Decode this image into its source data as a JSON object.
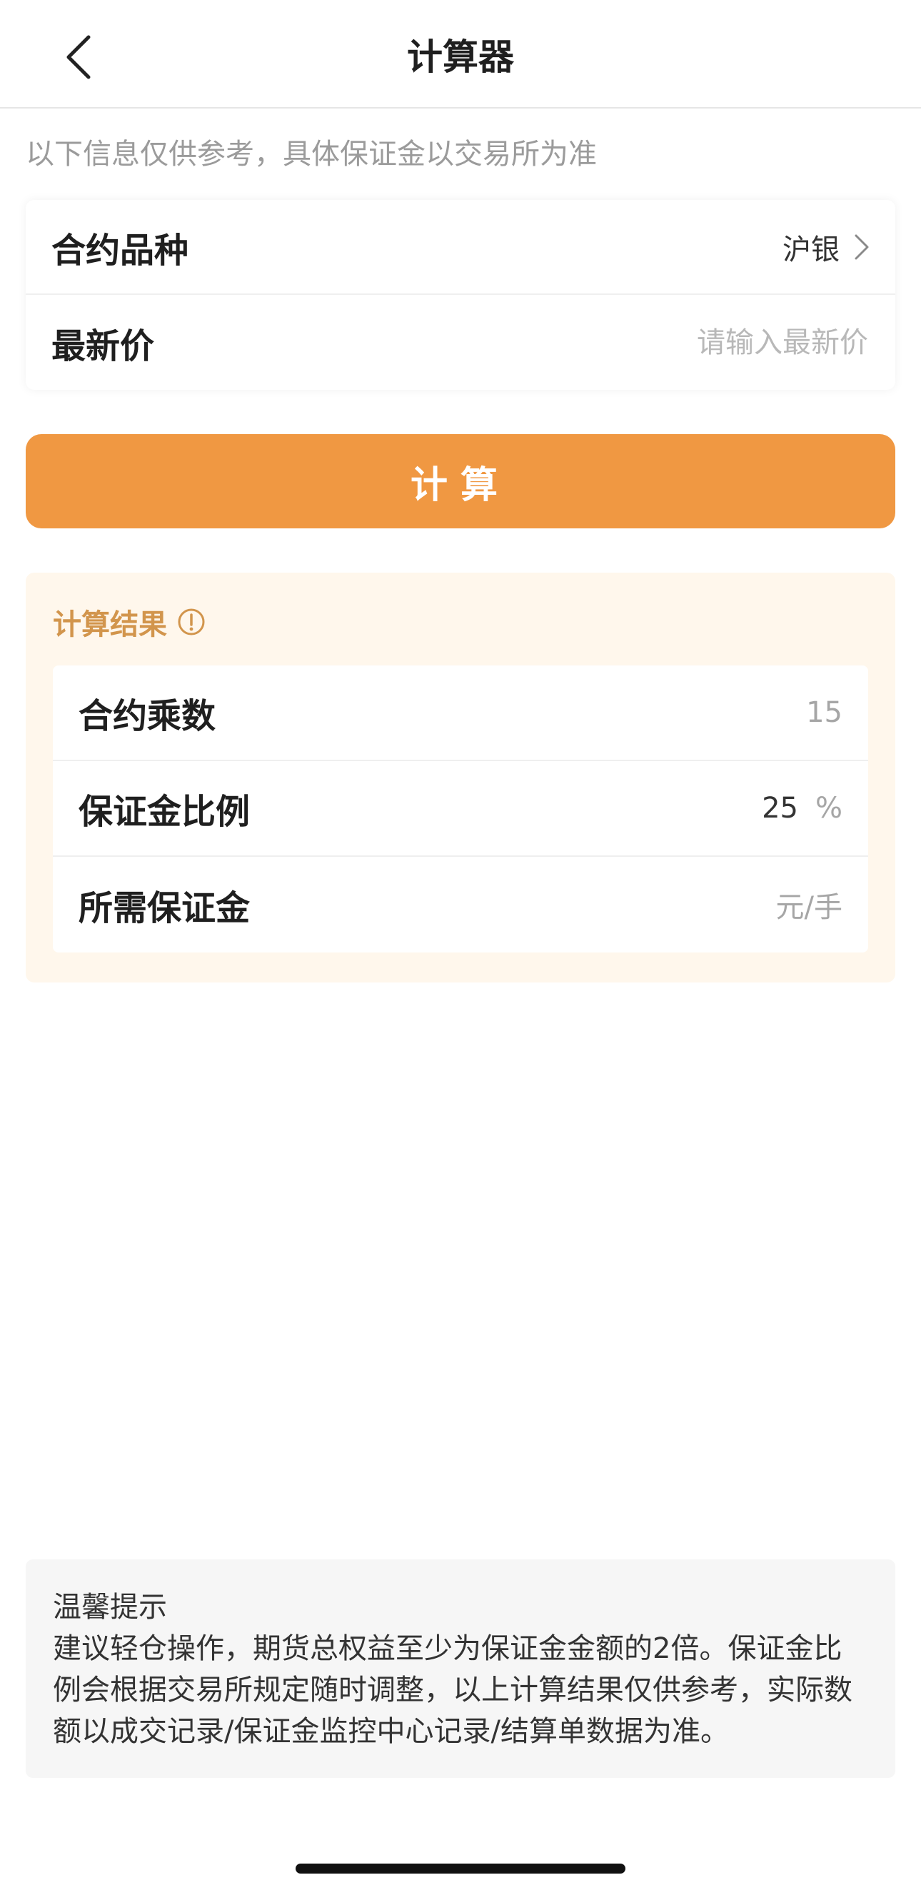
{
  "header": {
    "title": "计算器"
  },
  "notice": "以下信息仅供参考，具体保证金以交易所为准",
  "inputs": {
    "variety_label": "合约品种",
    "variety_value": "沪银",
    "price_label": "最新价",
    "price_placeholder": "请输入最新价",
    "price_value": ""
  },
  "calc_button_label": "计算",
  "result": {
    "title": "计算结果",
    "multiplier_label": "合约乘数",
    "multiplier_value": "15",
    "ratio_label": "保证金比例",
    "ratio_value": "25",
    "ratio_unit": "%",
    "required_label": "所需保证金",
    "required_unit": "元/手"
  },
  "tip": {
    "title": "温馨提示",
    "text": "建议轻仓操作，期货总权益至少为保证金金额的2倍。保证金比例会根据交易所规定随时调整，以上计算结果仅供参考，实际数额以成交记录/保证金监控中心记录/结算单数据为准。"
  },
  "colors": {
    "accent": "#f09842",
    "result_title": "#d2954c",
    "result_bg": "#fff7ec"
  }
}
